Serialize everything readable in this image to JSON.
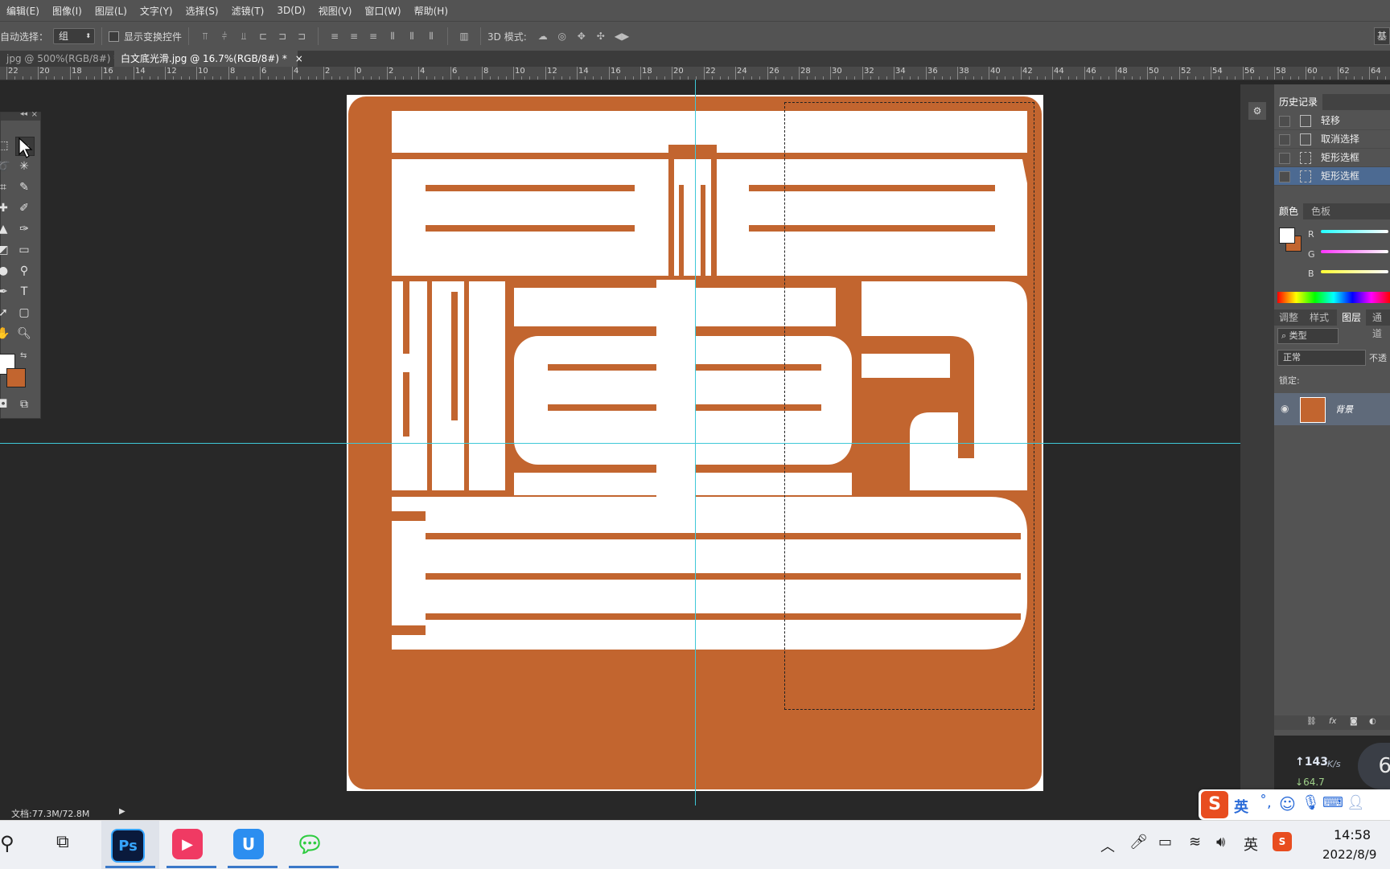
{
  "menu": [
    "编辑(E)",
    "图像(I)",
    "图层(L)",
    "文字(Y)",
    "选择(S)",
    "滤镜(T)",
    "3D(D)",
    "视图(V)",
    "窗口(W)",
    "帮助(H)"
  ],
  "options": {
    "auto_select_label": "自动选择：",
    "auto_select_value": "组",
    "show_transform_label": "显示变换控件",
    "mode_3d_label": "3D 模式:",
    "right_btn": "基"
  },
  "tabs": [
    {
      "title": "jpg @ 500%(RGB/8#) *",
      "close": "×",
      "active": false
    },
    {
      "title": "白文底光滑.jpg @ 16.7%(RGB/8#) *",
      "close": "×",
      "active": true
    }
  ],
  "ruler": {
    "ticks": [
      "22",
      "20",
      "18",
      "16",
      "14",
      "12",
      "10",
      "8",
      "6",
      "4",
      "2",
      "0",
      "2",
      "4",
      "6",
      "8",
      "10",
      "12",
      "14",
      "16",
      "18",
      "20",
      "22",
      "24",
      "26",
      "28",
      "30",
      "32",
      "34",
      "36",
      "38",
      "40",
      "42",
      "44",
      "46",
      "48",
      "50",
      "52",
      "54",
      "56",
      "58",
      "60",
      "62",
      "64"
    ]
  },
  "history": {
    "tab": "历史记录",
    "items": [
      {
        "label": "轻移",
        "icon": "document-icon"
      },
      {
        "label": "取消选择",
        "icon": "document-icon"
      },
      {
        "label": "矩形选框",
        "icon": "marquee-icon"
      },
      {
        "label": "矩形选框",
        "icon": "marquee-icon",
        "active": true
      }
    ]
  },
  "color_panel": {
    "tabs": [
      "颜色",
      "色板"
    ],
    "channels": [
      "R",
      "G",
      "B"
    ],
    "foreground": "#ffffff",
    "background": "#c2652f"
  },
  "layers_panel": {
    "tabs": [
      "调整",
      "样式",
      "图层",
      "通道"
    ],
    "filter": "类型",
    "blend": "正常",
    "opacity_label": "不透",
    "lock_label": "锁定:",
    "layer_name": "背景"
  },
  "status": {
    "doc": "文档:77.3M/72.8M"
  },
  "canvas": {
    "seal_color": "#c2652f"
  },
  "net_speed": {
    "up": "143",
    "unit": "K/s",
    "down": "64.7",
    "gauge": "6"
  },
  "ime": {
    "lang": "英"
  },
  "taskbar": {
    "apps": [
      "Ps",
      "U"
    ],
    "tray_lang": "英",
    "time": "14:58",
    "date": "2022/8/9"
  }
}
